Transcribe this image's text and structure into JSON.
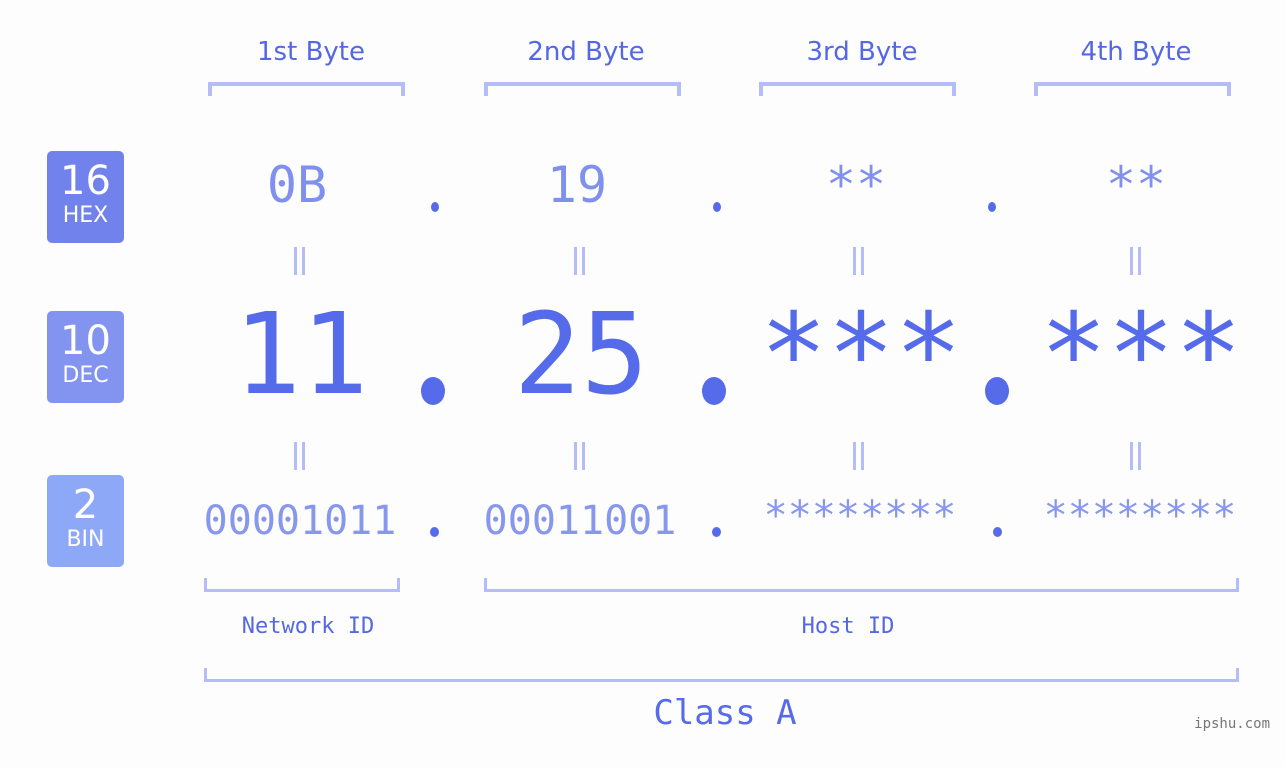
{
  "colors": {
    "hex_badge": "#7282ec",
    "dec_badge": "#8393f0",
    "bin_badge": "#8ea8f8",
    "accent": "#556bea",
    "bracket": "#b4bdf8"
  },
  "badges": [
    {
      "number": "16",
      "label": "HEX"
    },
    {
      "number": "10",
      "label": "DEC"
    },
    {
      "number": "2",
      "label": "BIN"
    }
  ],
  "byte_headers": [
    "1st Byte",
    "2nd Byte",
    "3rd Byte",
    "4th Byte"
  ],
  "hex": [
    "0B",
    "19",
    "**",
    "**"
  ],
  "dec": [
    "11",
    "25",
    "***",
    "***"
  ],
  "bin": [
    "00001011",
    "00011001",
    "********",
    "********"
  ],
  "separator": ".",
  "equals_glyph": "||",
  "network_id_label": "Network ID",
  "host_id_label": "Host ID",
  "class_label": "Class A",
  "watermark": "ipshu.com"
}
